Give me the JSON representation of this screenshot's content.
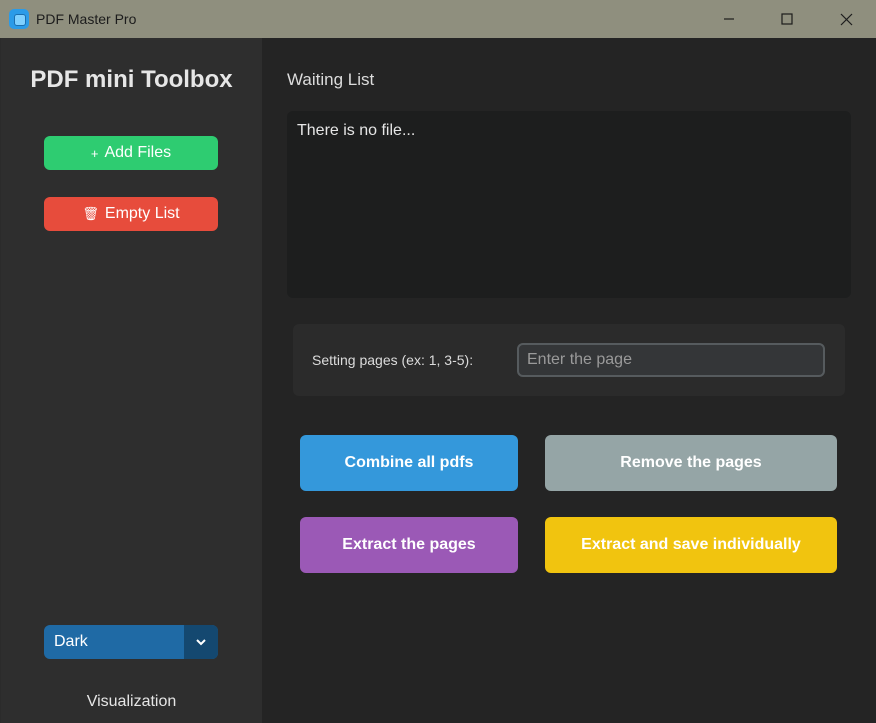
{
  "window": {
    "title": "PDF Master Pro"
  },
  "sidebar": {
    "brand": "PDF mini Toolbox",
    "add_files_glyph": "+",
    "add_files_label": "Add Files",
    "empty_list_glyph": "🗑",
    "empty_list_label": "Empty List",
    "theme_value": "Dark",
    "visualization_label": "Visualization"
  },
  "main": {
    "waiting_list_title": "Waiting List",
    "file_list_text": "There is no file...",
    "pages_label": "Setting pages (ex: 1, 3-5):",
    "pages_placeholder": "Enter the page",
    "pages_value": "",
    "buttons": {
      "combine": "Combine all pdfs",
      "remove": "Remove the pages",
      "extract": "Extract the pages",
      "extract_individually": "Extract and save individually"
    }
  },
  "colors": {
    "add": "#2ecc71",
    "empty": "#e74c3c",
    "combine": "#3498db",
    "remove": "#95a5a6",
    "extract": "#9b59b6",
    "extract_individually": "#f1c40f",
    "theme_select": "#1f6aa5"
  },
  "icons": {
    "app": "app-logo-icon",
    "minimize": "minimize-icon",
    "maximize": "maximize-icon",
    "close": "close-icon",
    "dropdown": "chevron-down-icon"
  }
}
